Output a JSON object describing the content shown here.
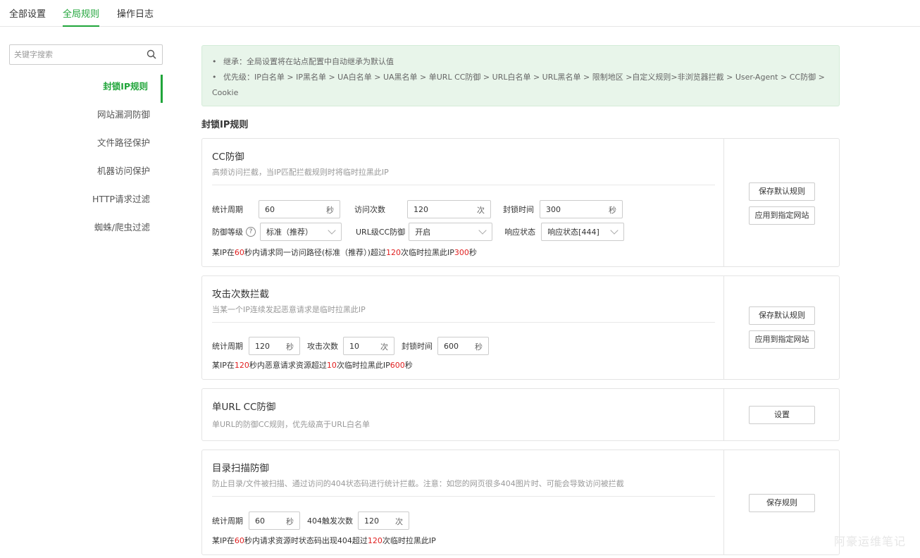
{
  "tabs": [
    "全部设置",
    "全局规则",
    "操作日志"
  ],
  "search": {
    "placeholder": "关键字搜索"
  },
  "sidebar": [
    "封锁IP规则",
    "网站漏洞防御",
    "文件路径保护",
    "机器访问保护",
    "HTTP请求过滤",
    "蜘蛛/爬虫过滤"
  ],
  "notice": {
    "line1": "继承：全局设置将在站点配置中自动继承为默认值",
    "line2a": "优先级：IP白名单 > IP黑名单 > UA白名单 > UA黑名单 > 单URL CC防御 > URL白名单 > URL黑名单 > 限制地区 >自定义规则>非浏览器拦截 > User-Agent > CC防御 >",
    "line2b": "Cookie"
  },
  "section_title": "封锁IP规则",
  "cc": {
    "title": "CC防御",
    "desc": "高频访问拦截，当IP匹配拦截规则时将临时拉黑此IP",
    "period_label": "统计周期",
    "period_value": "60",
    "period_unit": "秒",
    "count_label": "访问次数",
    "count_value": "120",
    "count_unit": "次",
    "block_label": "封锁时间",
    "block_value": "300",
    "block_unit": "秒",
    "level_label": "防御等级",
    "help": "?",
    "level_value": "标准（推荐）",
    "url_label": "URL级CC防御",
    "url_value": "开启",
    "resp_label": "响应状态",
    "resp_value": "响应状态[444]",
    "sum": [
      "某IP在",
      "60",
      "秒内请求同一访问路径(标准（推荐）)超过",
      "120",
      "次临时拉黑此IP",
      "300",
      "秒"
    ],
    "btn_save": "保存默认规则",
    "btn_apply": "应用到指定网站"
  },
  "attack": {
    "title": "攻击次数拦截",
    "desc": "当某一个IP连续发起恶意请求是临时拉黑此IP",
    "period_label": "统计周期",
    "period_value": "120",
    "period_unit": "秒",
    "count_label": "攻击次数",
    "count_value": "10",
    "count_unit": "次",
    "block_label": "封锁时间",
    "block_value": "600",
    "block_unit": "秒",
    "sum": [
      "某IP在",
      "120",
      "秒内恶意请求资源超过",
      "10",
      "次临时拉黑此IP",
      "600",
      "秒"
    ],
    "btn_save": "保存默认规则",
    "btn_apply": "应用到指定网站"
  },
  "single_url": {
    "title": "单URL CC防御",
    "desc": "单URL的防御CC规则，优先级高于URL白名单",
    "btn": "设置"
  },
  "scan": {
    "title": "目录扫描防御",
    "desc": "防止目录/文件被扫描、通过访问的404状态码进行统计拦截。注意：如您的网页很多404图片时、可能会导致访问被拦截",
    "period_label": "统计周期",
    "period_value": "60",
    "period_unit": "秒",
    "trigger_label": "404触发次数",
    "trigger_value": "120",
    "trigger_unit": "次",
    "sum": [
      "某IP在",
      "60",
      "秒内请求资源时状态码出现404超过",
      "120",
      "次临时拉黑此IP"
    ],
    "btn": "保存规则"
  },
  "watermark": "阿豪运维笔记",
  "colors": {
    "accent": "#20a53a",
    "highlight": "#e02020",
    "notice_bg": "#e8f5ea"
  }
}
